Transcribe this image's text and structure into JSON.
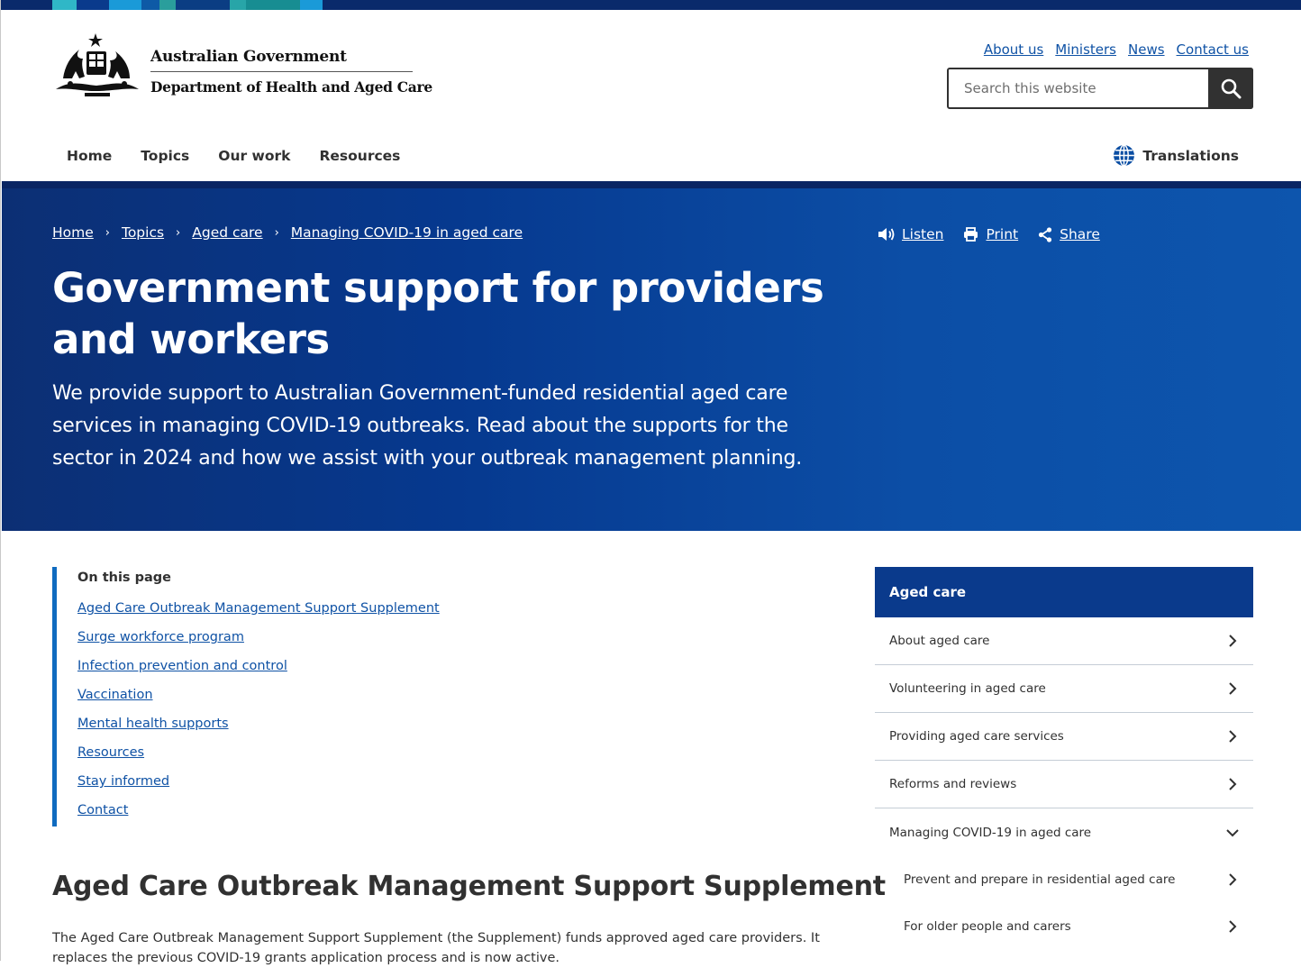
{
  "header": {
    "org_line1": "Australian Government",
    "org_line2": "Department of Health and Aged Care",
    "util_links": [
      "About us",
      "Ministers",
      "News",
      "Contact us"
    ],
    "search_placeholder": "Search this website",
    "nav": [
      "Home",
      "Topics",
      "Our work",
      "Resources"
    ],
    "active_nav": "Topics",
    "translations_label": "Translations"
  },
  "hero": {
    "breadcrumbs": [
      "Home",
      "Topics",
      "Aged care",
      "Managing COVID-19 in aged care"
    ],
    "tools": [
      "Listen",
      "Print",
      "Share"
    ],
    "title": "Government support for providers and workers",
    "intro": "We provide support to Australian Government-funded residential aged care services in managing COVID-19 outbreaks. Read about the supports for the sector in 2024 and how we assist with your outbreak management planning."
  },
  "on_this_page": {
    "title": "On this page",
    "links": [
      "Aged Care Outbreak Management Support Supplement",
      "Surge workforce program",
      "Infection prevention and control",
      "Vaccination",
      "Mental health supports",
      "Resources",
      "Stay informed",
      "Contact"
    ]
  },
  "section": {
    "heading": "Aged Care Outbreak Management Support Supplement",
    "paragraph": "The Aged Care Outbreak Management Support Supplement (the Supplement) funds approved aged care providers. It replaces the previous COVID-19 grants application process and is now active."
  },
  "side_nav": {
    "heading": "Aged care",
    "items": [
      "About aged care",
      "Volunteering in aged care",
      "Providing aged care services",
      "Reforms and reviews",
      "Managing COVID-19 in aged care"
    ],
    "sub_items": [
      "Prevent and prepare in residential aged care",
      "For older people and carers"
    ]
  },
  "colors": {
    "hero_blue": "#06398f",
    "link_blue": "#0f52a5",
    "side_head_blue": "#0a3a8c",
    "dark": "#313131"
  }
}
